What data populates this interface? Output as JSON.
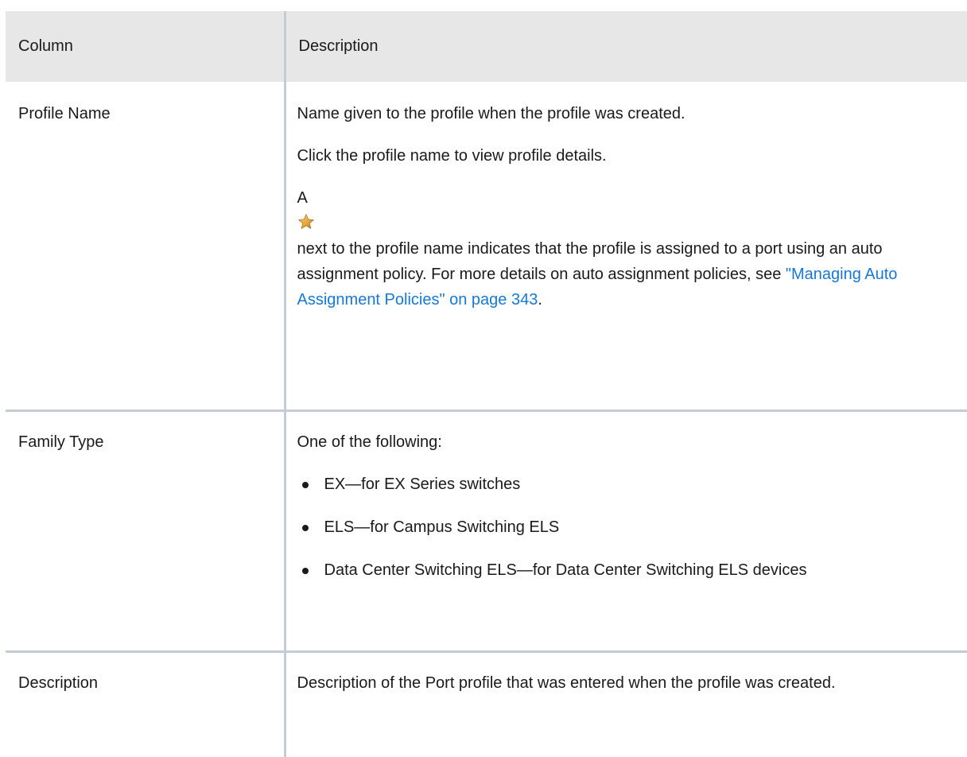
{
  "table": {
    "headers": {
      "column": "Column",
      "description": "Description"
    },
    "rows": [
      {
        "name": "Profile Name",
        "desc_1": "Name given to the profile when the profile was created.",
        "desc_2": "Click the profile name to view profile details.",
        "desc_3_prefix": "A",
        "star_icon": "star-icon",
        "desc_3_suffix": "next to the profile name indicates that the profile is assigned to a port using an auto assignment policy. For more details on auto assignment policies, see ",
        "link_text": "\"Managing Auto Assignment Policies\" on page 343",
        "desc_3_end": "."
      },
      {
        "name": "Family Type",
        "intro": "One of the following:",
        "bullets": [
          "EX—for EX Series switches",
          "ELS—for Campus Switching ELS",
          "Data Center Switching ELS—for Data Center Switching ELS devices"
        ]
      },
      {
        "name": "Description",
        "desc": "Description of the Port profile that was entered when the profile was created."
      }
    ]
  },
  "colors": {
    "header_bg": "#e7e7e7",
    "border": "#c4ccd6",
    "link": "#1778d5",
    "text": "#1a1a1a"
  }
}
